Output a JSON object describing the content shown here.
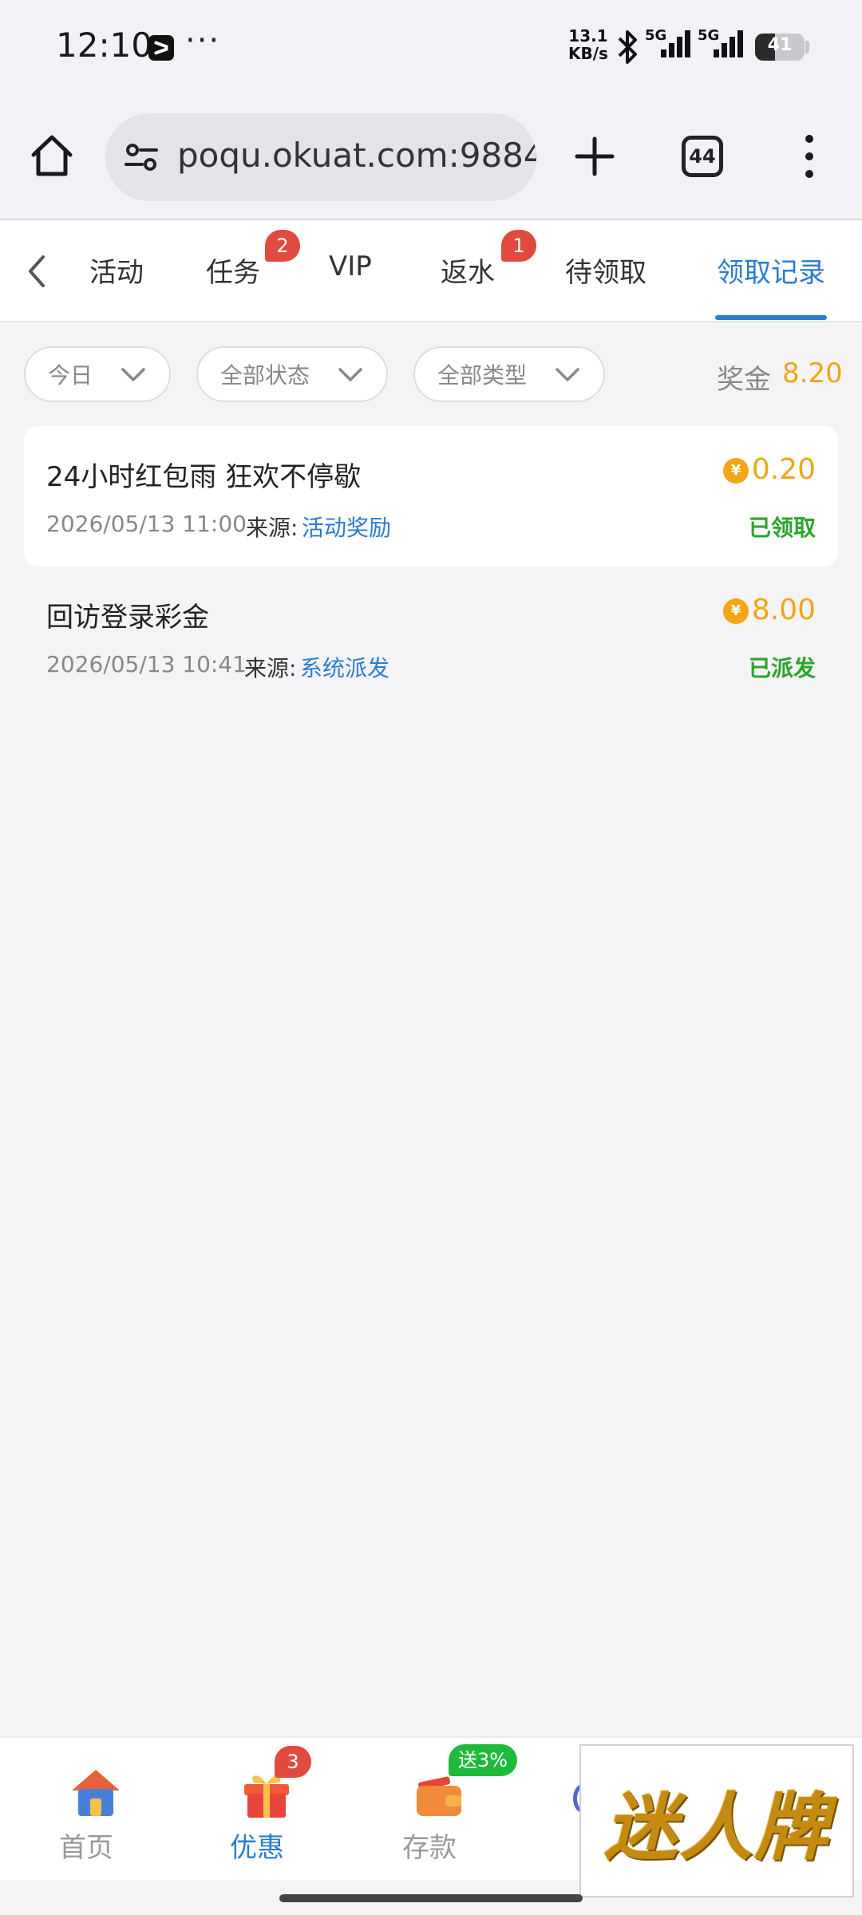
{
  "status_bar": {
    "time": "12:10",
    "speed_value": "13.1",
    "speed_unit": "KB/s",
    "network_1": "5G",
    "network_2": "5G",
    "battery": "41",
    "battery_level": 0.41,
    "more": "···"
  },
  "browser": {
    "url": "poqu.okuat.com:9884",
    "tab_count": "44"
  },
  "tabs": [
    {
      "label": "活动"
    },
    {
      "label": "任务",
      "badge": "2"
    },
    {
      "label": "VIP"
    },
    {
      "label": "返水",
      "badge": "1"
    },
    {
      "label": "待领取"
    },
    {
      "label": "领取记录",
      "active": true
    }
  ],
  "filters": {
    "date": "今日",
    "status": "全部状态",
    "type": "全部类型",
    "bonus_label": "奖金",
    "bonus_value": "8.20"
  },
  "records": [
    {
      "title": "24小时红包雨 狂欢不停歇",
      "datetime": "2026/05/13 11:00",
      "source_label": "来源:",
      "source": "活动奖励",
      "currency_symbol": "¥",
      "amount": "0.20",
      "status": "已领取"
    },
    {
      "title": "回访登录彩金",
      "datetime": "2026/05/13 10:41",
      "source_label": "来源:",
      "source": "系统派发",
      "currency_symbol": "¥",
      "amount": "8.00",
      "status": "已派发"
    }
  ],
  "bottom_nav": {
    "items": [
      {
        "label": "首页"
      },
      {
        "label": "优惠",
        "badge": "3",
        "active": true
      },
      {
        "label": "存款",
        "promo": "送3%"
      }
    ]
  },
  "overlay": {
    "logo_text": "迷人牌"
  },
  "colors": {
    "accent": "#2a7bd0",
    "gold": "#f0a516",
    "success": "#2aa52a",
    "badge": "#e04a3f"
  }
}
